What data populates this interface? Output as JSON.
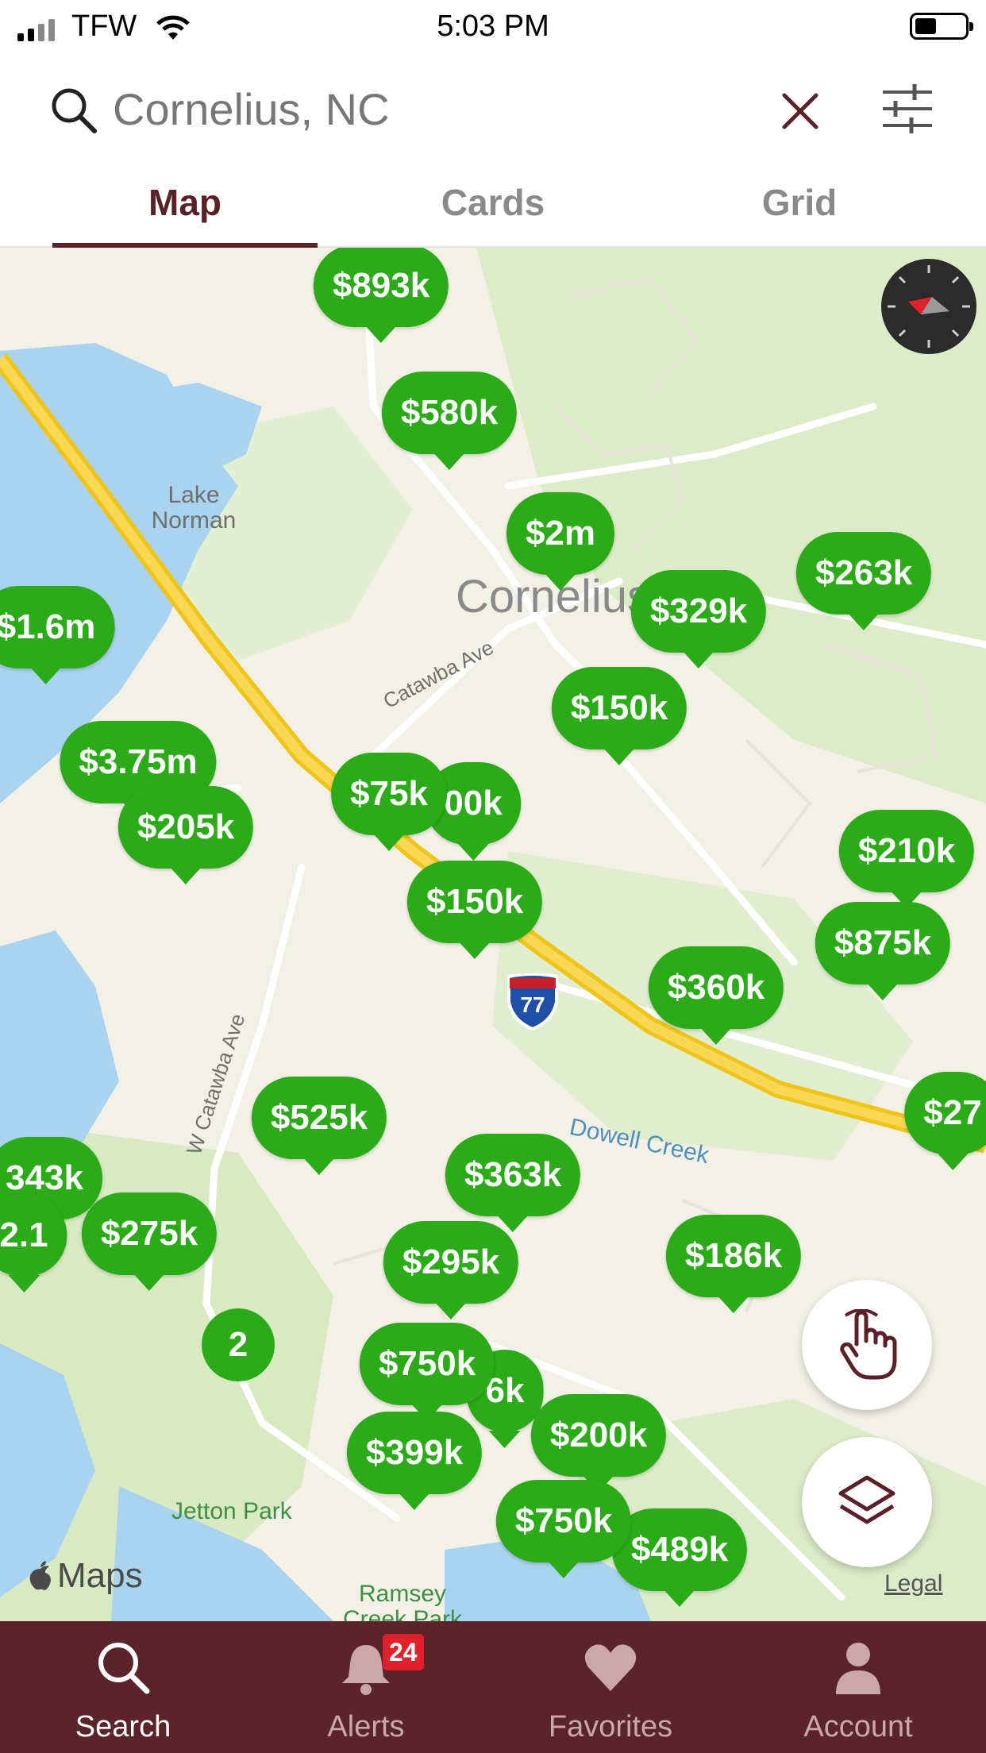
{
  "status_bar": {
    "carrier": "TFW",
    "time": "5:03 PM"
  },
  "search": {
    "value": "Cornelius, NC",
    "search_icon": "search-icon",
    "clear_icon": "close-icon",
    "filter_icon": "sliders-icon"
  },
  "tabs": [
    {
      "label": "Map",
      "active": true
    },
    {
      "label": "Cards",
      "active": false
    },
    {
      "label": "Grid",
      "active": false
    }
  ],
  "map": {
    "labels": {
      "lake": "Lake\nNorman",
      "town": "Cornelius",
      "catawba": "Catawba Ave",
      "w_catawba": "W Catawba Ave",
      "creek": "Dowell Creek",
      "interstate": "77",
      "jetton": "Jetton Park",
      "ramsey": "Ramsey\nCreek Park"
    },
    "price_pins": [
      "$893k",
      "$580k",
      "$2m",
      "$263k",
      "$329k",
      "$1.6m",
      "$150k",
      "$3.75m",
      "$205k",
      "$75k",
      "00k",
      "$150k",
      "$210k",
      "$875k",
      "$360k",
      "$27",
      "$525k",
      "343k",
      "2.1",
      "$275k",
      "$363k",
      "$295k",
      "$186k",
      "$750k",
      "6k",
      "$200k",
      "$399k",
      "$750k",
      "$489k"
    ],
    "cluster_count": "2",
    "attribution": "Maps",
    "legal": "Legal"
  },
  "tab_bar": [
    {
      "label": "Search",
      "icon": "search-icon",
      "active": true
    },
    {
      "label": "Alerts",
      "icon": "bell-icon",
      "badge": "24",
      "active": false
    },
    {
      "label": "Favorites",
      "icon": "heart-icon",
      "active": false
    },
    {
      "label": "Account",
      "icon": "person-icon",
      "active": false
    }
  ],
  "colors": {
    "brand": "#5b242b",
    "pin_green": "#2aab17",
    "badge_red": "#e0212b"
  }
}
